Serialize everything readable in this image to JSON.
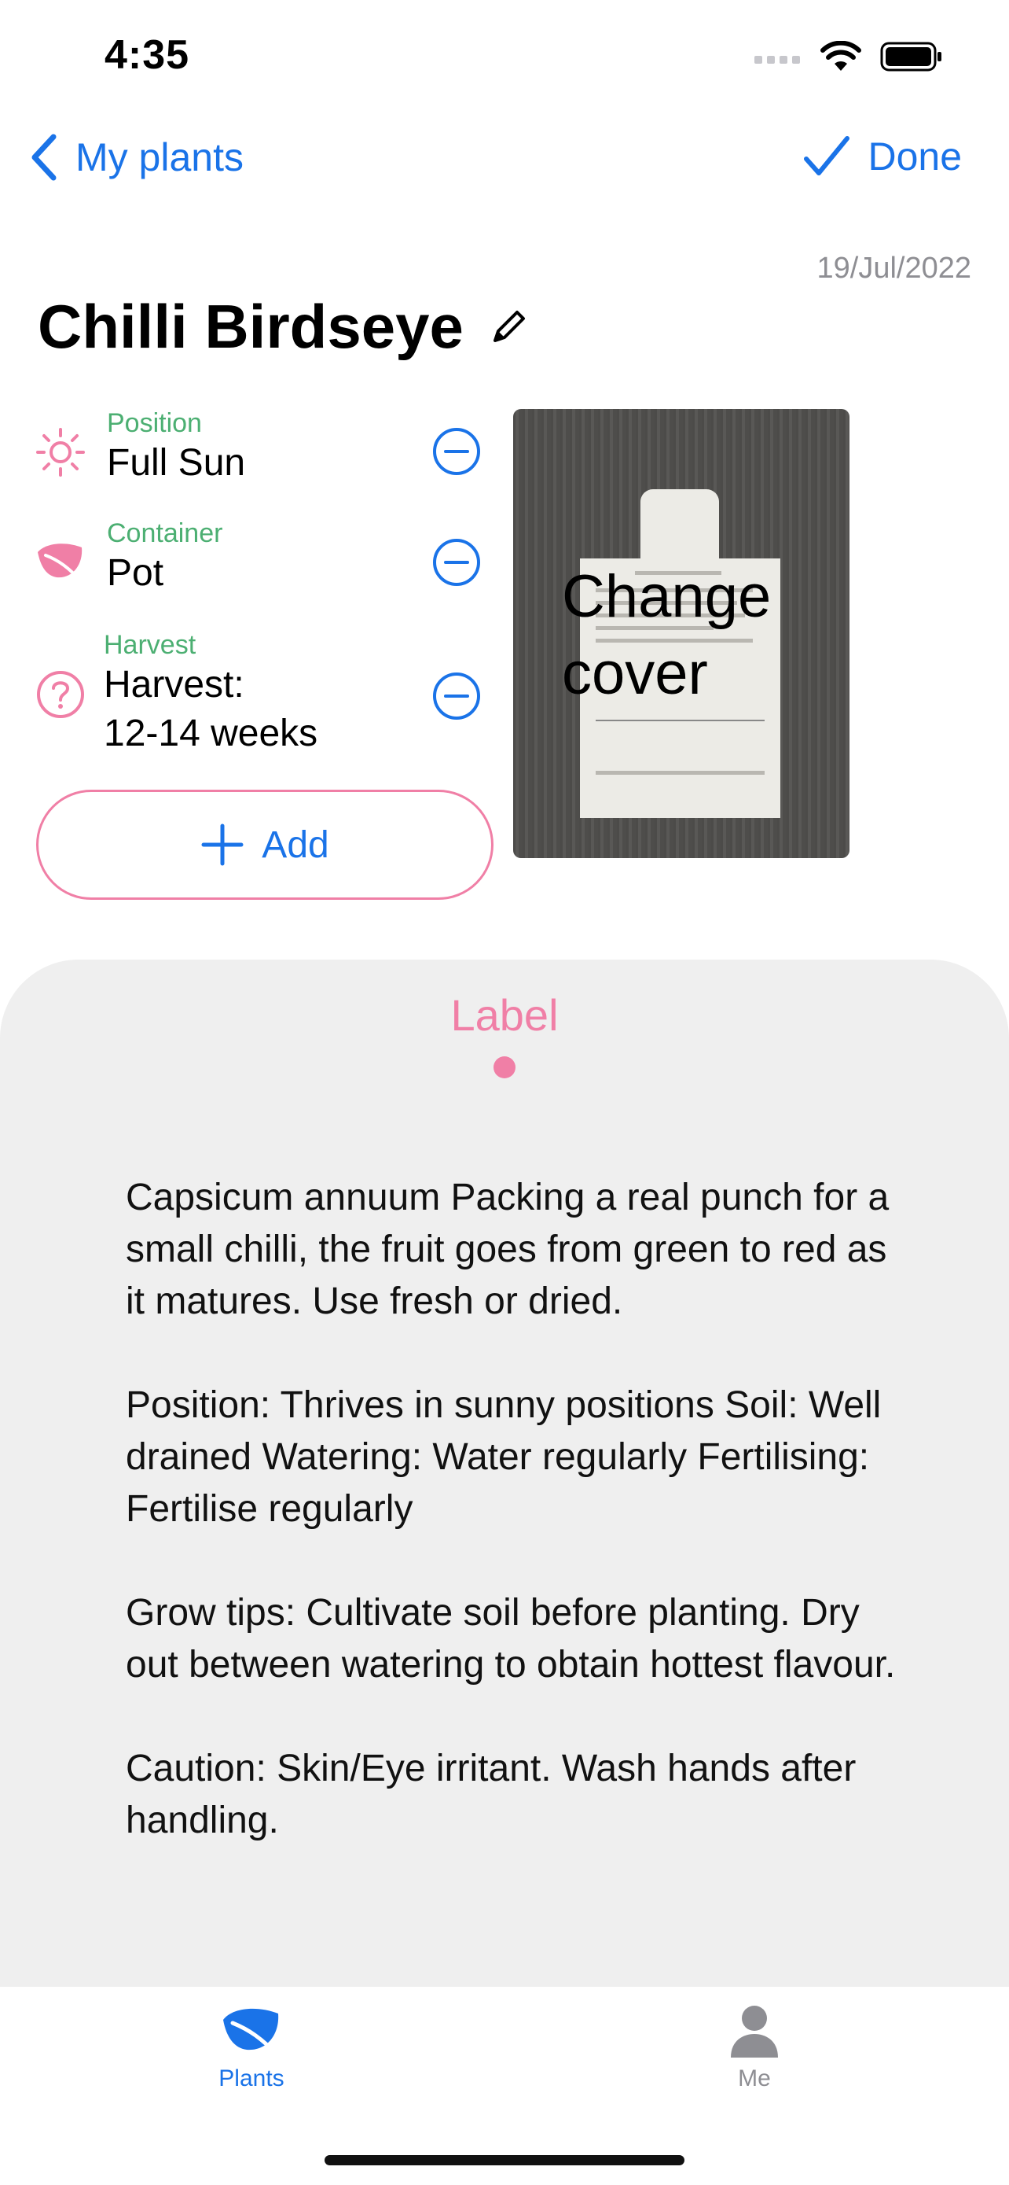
{
  "status_bar": {
    "time": "4:35"
  },
  "nav": {
    "back_label": "My plants",
    "done_label": "Done"
  },
  "plant": {
    "date": "19/Jul/2022",
    "name": "Chilli Birdseye"
  },
  "attributes": [
    {
      "category": "Position",
      "value": "Full Sun",
      "icon": "sun-icon"
    },
    {
      "category": "Container",
      "value": "Pot",
      "icon": "leaf-icon"
    },
    {
      "category": "Harvest",
      "value": "Harvest:\n12-14 weeks",
      "icon": "question-circle-icon"
    }
  ],
  "add_button": {
    "label": "Add"
  },
  "cover": {
    "label": "Change\ncover"
  },
  "sheet": {
    "title": "Label",
    "paragraphs": [
      "Capsicum annuum Packing a real punch for a small chilli, the fruit goes from green to red as it matures. Use fresh or dried.",
      "Position: Thrives in sunny positions Soil: Well drained Watering: Water regularly Fertilising: Fertilise regularly",
      "Grow tips: Cultivate soil before planting. Dry out between watering to obtain hottest flavour.",
      "Caution: Skin/Eye irritant. Wash hands after handling."
    ]
  },
  "tabs": [
    {
      "label": "Plants",
      "active": true,
      "icon": "leaf-icon"
    },
    {
      "label": "Me",
      "active": false,
      "icon": "person-icon"
    }
  ],
  "colors": {
    "accent": "#1a73e8",
    "pink": "#f07fa6",
    "green": "#4caf72",
    "sheet": "#efefef",
    "inactive": "#8e8e93"
  }
}
